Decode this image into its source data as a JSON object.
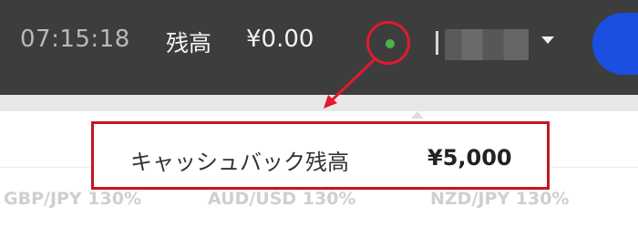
{
  "header": {
    "clock": "07:15:18",
    "balance_label": "残高",
    "balance_value": "¥0.00",
    "connection_status_color": "#4cb548",
    "user_menu_icon": "caret-down-icon"
  },
  "popup": {
    "cashback_label": "キャッシュバック残高",
    "cashback_value": "¥5,000"
  },
  "ticker": {
    "items": [
      "GBP/JPY 130%",
      "AUD/USD 130%",
      "NZD/JPY 130%"
    ]
  },
  "colors": {
    "topbar": "#3d3d3d",
    "highlight": "#e3192e",
    "accent": "#1a4fe0"
  }
}
